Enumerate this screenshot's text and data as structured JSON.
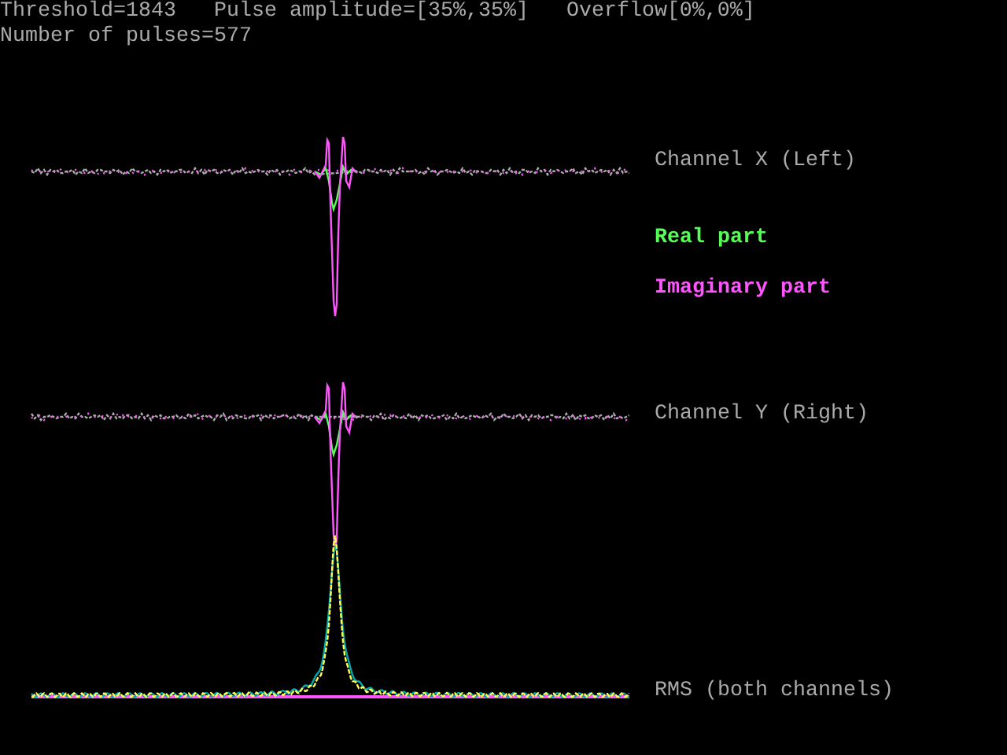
{
  "header": {
    "threshold": "Threshold=1843",
    "pulse_amplitude": "Pulse amplitude=[35%,35%]",
    "overflow": "Overflow[0%,0%]",
    "pulse_count": "Number of pulses=577"
  },
  "labels": [
    {
      "kind": "channel",
      "text": "Channel X (Left)"
    },
    {
      "kind": "legend",
      "text": "Real part",
      "color": "#55ff55"
    },
    {
      "kind": "legend",
      "text": "Imaginary part",
      "color": "#ff55ff"
    },
    {
      "kind": "channel",
      "text": "Channel Y (Right)"
    },
    {
      "kind": "channel",
      "text": "RMS (both channels)"
    }
  ]
}
